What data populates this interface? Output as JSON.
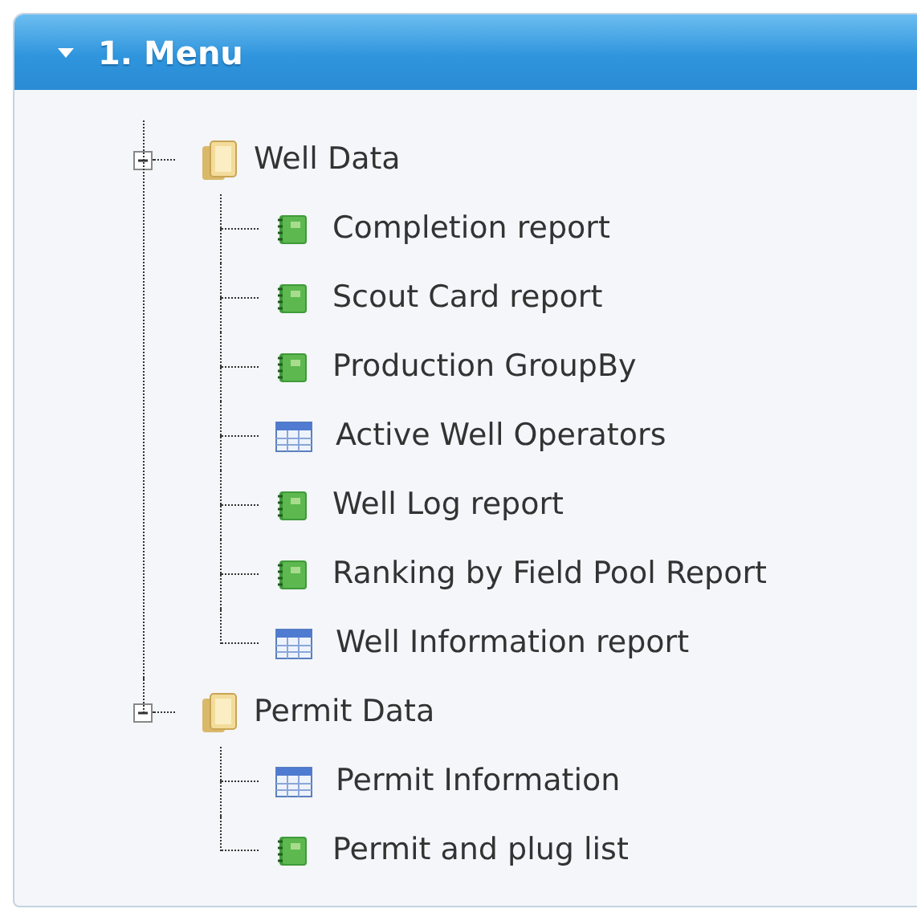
{
  "panel": {
    "title": "1. Menu",
    "expanded": true
  },
  "tree": [
    {
      "label": "Well Data",
      "expanded": true,
      "children": [
        {
          "label": "Completion report",
          "kind": "report"
        },
        {
          "label": "Scout Card report",
          "kind": "report"
        },
        {
          "label": "Production GroupBy",
          "kind": "report"
        },
        {
          "label": "Active Well Operators",
          "kind": "table"
        },
        {
          "label": "Well Log report",
          "kind": "report"
        },
        {
          "label": "Ranking by Field Pool Report",
          "kind": "report"
        },
        {
          "label": "Well Information report",
          "kind": "table"
        }
      ]
    },
    {
      "label": "Permit Data",
      "expanded": true,
      "children": [
        {
          "label": "Permit Information",
          "kind": "table"
        },
        {
          "label": "Permit and plug list",
          "kind": "report"
        }
      ]
    }
  ]
}
